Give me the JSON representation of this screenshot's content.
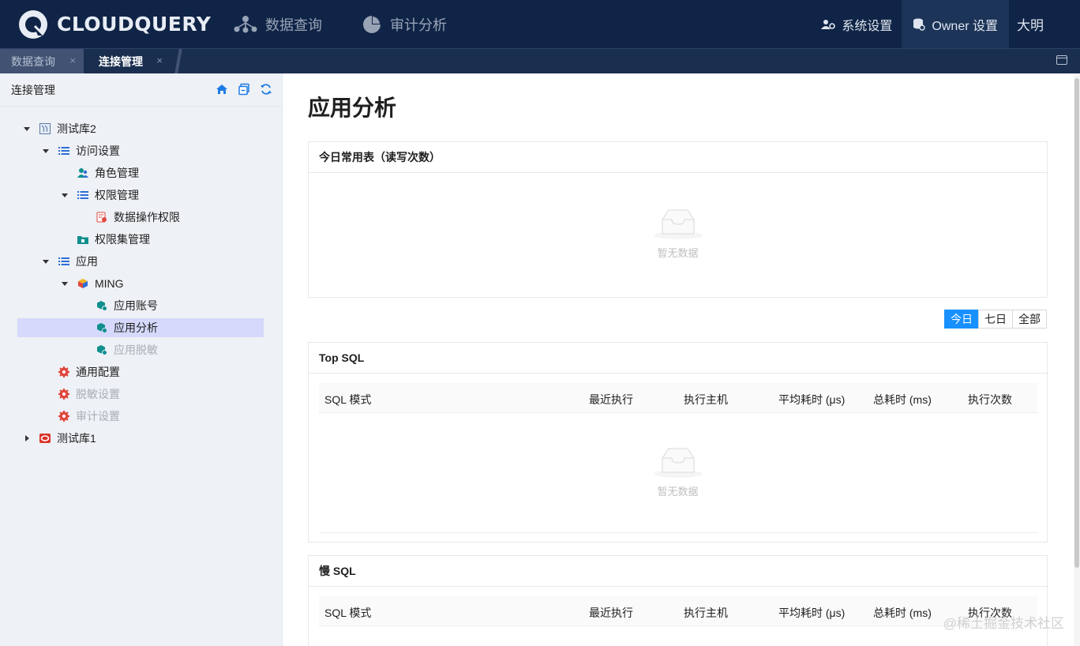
{
  "app": {
    "logo_text": "CLOUDQUERY"
  },
  "nav": {
    "query_label": "数据查询",
    "audit_label": "审计分析"
  },
  "top_right": {
    "system_settings": "系统设置",
    "owner_settings": "Owner 设置",
    "user_name": "大明"
  },
  "tabs": [
    {
      "label": "数据查询",
      "close": "×"
    },
    {
      "label": "连接管理",
      "close": "×"
    }
  ],
  "sidebar": {
    "title": "连接管理",
    "tree": {
      "db2": "测试库2",
      "access_settings": "访问设置",
      "role_mgmt": "角色管理",
      "perm_mgmt": "权限管理",
      "data_op_perm": "数据操作权限",
      "perm_set_mgmt": "权限集管理",
      "app": "应用",
      "ming": "MING",
      "app_account": "应用账号",
      "app_analysis": "应用分析",
      "app_desensitize": "应用脱敏",
      "general_config": "通用配置",
      "desensitize_settings": "脱敏设置",
      "audit_settings": "审计设置",
      "db1": "测试库1"
    }
  },
  "main": {
    "title": "应用分析",
    "today_tables": {
      "title": "今日常用表（读写次数）",
      "empty": "暂无数据"
    },
    "range": {
      "today": "今日",
      "seven_days": "七日",
      "all": "全部"
    },
    "top_sql": {
      "title": "Top SQL",
      "columns": [
        "SQL 模式",
        "最近执行",
        "执行主机",
        "平均耗时 (μs)",
        "总耗时 (ms)",
        "执行次数"
      ],
      "empty": "暂无数据"
    },
    "slow_sql": {
      "title": "慢 SQL",
      "columns": [
        "SQL 模式",
        "最近执行",
        "执行主机",
        "平均耗时 (μs)",
        "总耗时 (ms)",
        "执行次数"
      ]
    }
  },
  "watermark": "@稀土掘金技术社区",
  "colors": {
    "topbar": "#0f2446",
    "accent": "#1890ff",
    "selected": "#d6d9fb"
  }
}
